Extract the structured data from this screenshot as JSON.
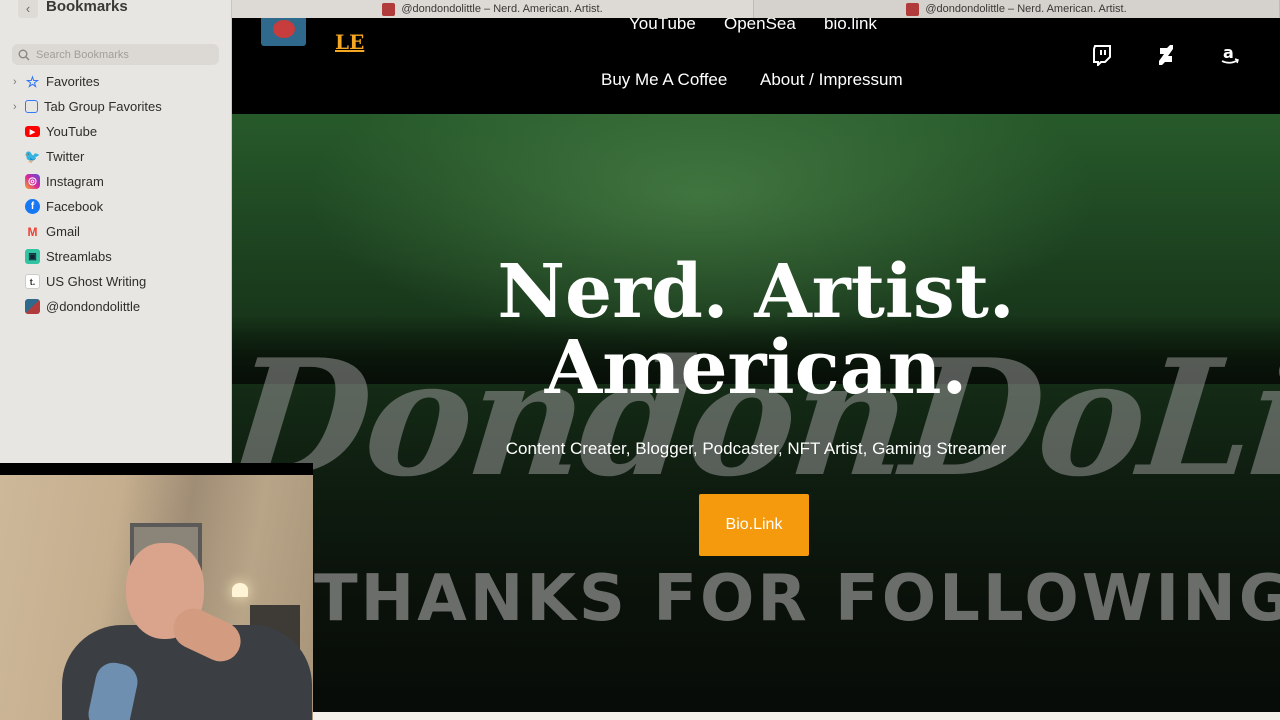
{
  "sidebar": {
    "title": "Bookmarks",
    "search_placeholder": "Search Bookmarks",
    "items": [
      {
        "label": "Favorites",
        "icon": "star-icon",
        "expandable": true
      },
      {
        "label": "Tab Group Favorites",
        "icon": "tab-group-icon",
        "expandable": true
      },
      {
        "label": "YouTube",
        "icon": "youtube-icon",
        "color": "#ff0000"
      },
      {
        "label": "Twitter",
        "icon": "twitter-icon",
        "color": "#1da1f2"
      },
      {
        "label": "Instagram",
        "icon": "instagram-icon",
        "color": "#d6249f"
      },
      {
        "label": "Facebook",
        "icon": "facebook-icon",
        "color": "#1877f2"
      },
      {
        "label": "Gmail",
        "icon": "gmail-icon",
        "color": "#ea4335"
      },
      {
        "label": "Streamlabs",
        "icon": "streamlabs-icon",
        "color": "#31c3a2"
      },
      {
        "label": "US Ghost Writing",
        "icon": "ghost-writing-icon",
        "color": "#ffffff"
      },
      {
        "label": "@dondondolittle",
        "icon": "site-favicon-icon",
        "color": "#b13a3a"
      }
    ]
  },
  "tabs": [
    {
      "title": "@dondondolittle – Nerd. American. Artist."
    },
    {
      "title": "@dondondolittle – Nerd. American. Artist."
    }
  ],
  "site": {
    "logo_text": "LE",
    "nav_top": [
      "YouTube",
      "OpenSea",
      "bio.link"
    ],
    "nav_second": [
      "Buy Me A Coffee",
      "About / Impressum"
    ],
    "social_icons": [
      "twitch-icon",
      "deviantart-icon",
      "amazon-icon"
    ],
    "hero": {
      "headline_line1": "Nerd. Artist.",
      "headline_line2": "American.",
      "subline": "Content Creater, Blogger, Podcaster, NFT Artist, Gaming Streamer",
      "cta_label": "Bio.Link",
      "watermark_script": "DondonDoLittl",
      "watermark_caption": "THANKS FOR FOLLOWING"
    },
    "accent_color": "#f59a0c"
  }
}
